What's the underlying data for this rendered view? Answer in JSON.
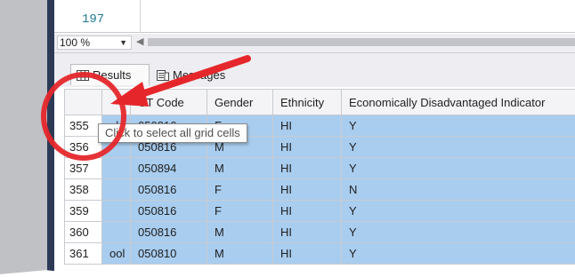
{
  "editor": {
    "line_number": "197"
  },
  "statusbar": {
    "zoom_value": "100 %"
  },
  "tabs": [
    {
      "label": "Results"
    },
    {
      "label": "Messages"
    }
  ],
  "grid": {
    "columns": [
      "",
      "",
      "CT Code",
      "Gender",
      "Ethnicity",
      "Economically Disadvantaged Indicator"
    ],
    "rows": [
      {
        "row_no": "355",
        "name": "ol",
        "code": "050816",
        "gender": "F",
        "ethnicity": "HI",
        "indicator": "Y"
      },
      {
        "row_no": "356",
        "name": "",
        "code": "050816",
        "gender": "M",
        "ethnicity": "HI",
        "indicator": "Y"
      },
      {
        "row_no": "357",
        "name": "",
        "code": "050894",
        "gender": "M",
        "ethnicity": "HI",
        "indicator": "Y"
      },
      {
        "row_no": "358",
        "name": "",
        "code": "050816",
        "gender": "F",
        "ethnicity": "HI",
        "indicator": "N"
      },
      {
        "row_no": "359",
        "name": "",
        "code": "050816",
        "gender": "F",
        "ethnicity": "HI",
        "indicator": "Y"
      },
      {
        "row_no": "360",
        "name": "",
        "code": "050816",
        "gender": "M",
        "ethnicity": "HI",
        "indicator": "Y"
      },
      {
        "row_no": "361",
        "name": "ool",
        "code": "050810",
        "gender": "M",
        "ethnicity": "HI",
        "indicator": "Y"
      }
    ]
  },
  "tooltip": {
    "text": "Click to select all grid cells"
  },
  "annotation": {
    "color": "#e5272b"
  },
  "colors": {
    "selection": "#a9cdef",
    "side_dark": "#2c3a56"
  }
}
